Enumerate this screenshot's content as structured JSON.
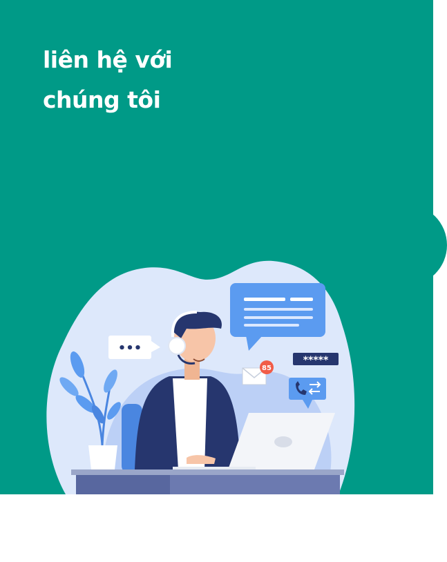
{
  "header": {
    "title_line1": "liên hệ với",
    "title_line2": "chúng tôi"
  },
  "illustration": {
    "chat_bubble_text": "•••",
    "notification_count": "85",
    "password_mask": "*****",
    "colors": {
      "panel": "#009a87",
      "bubble": "#5b9bf0",
      "jacket": "#26366e",
      "blob_light": "#dde8fb",
      "blob_mid": "#bcd0f6",
      "desk_top": "#9aa6c9",
      "desk_front": "#6c7ab0",
      "badge": "#f15c48"
    }
  }
}
